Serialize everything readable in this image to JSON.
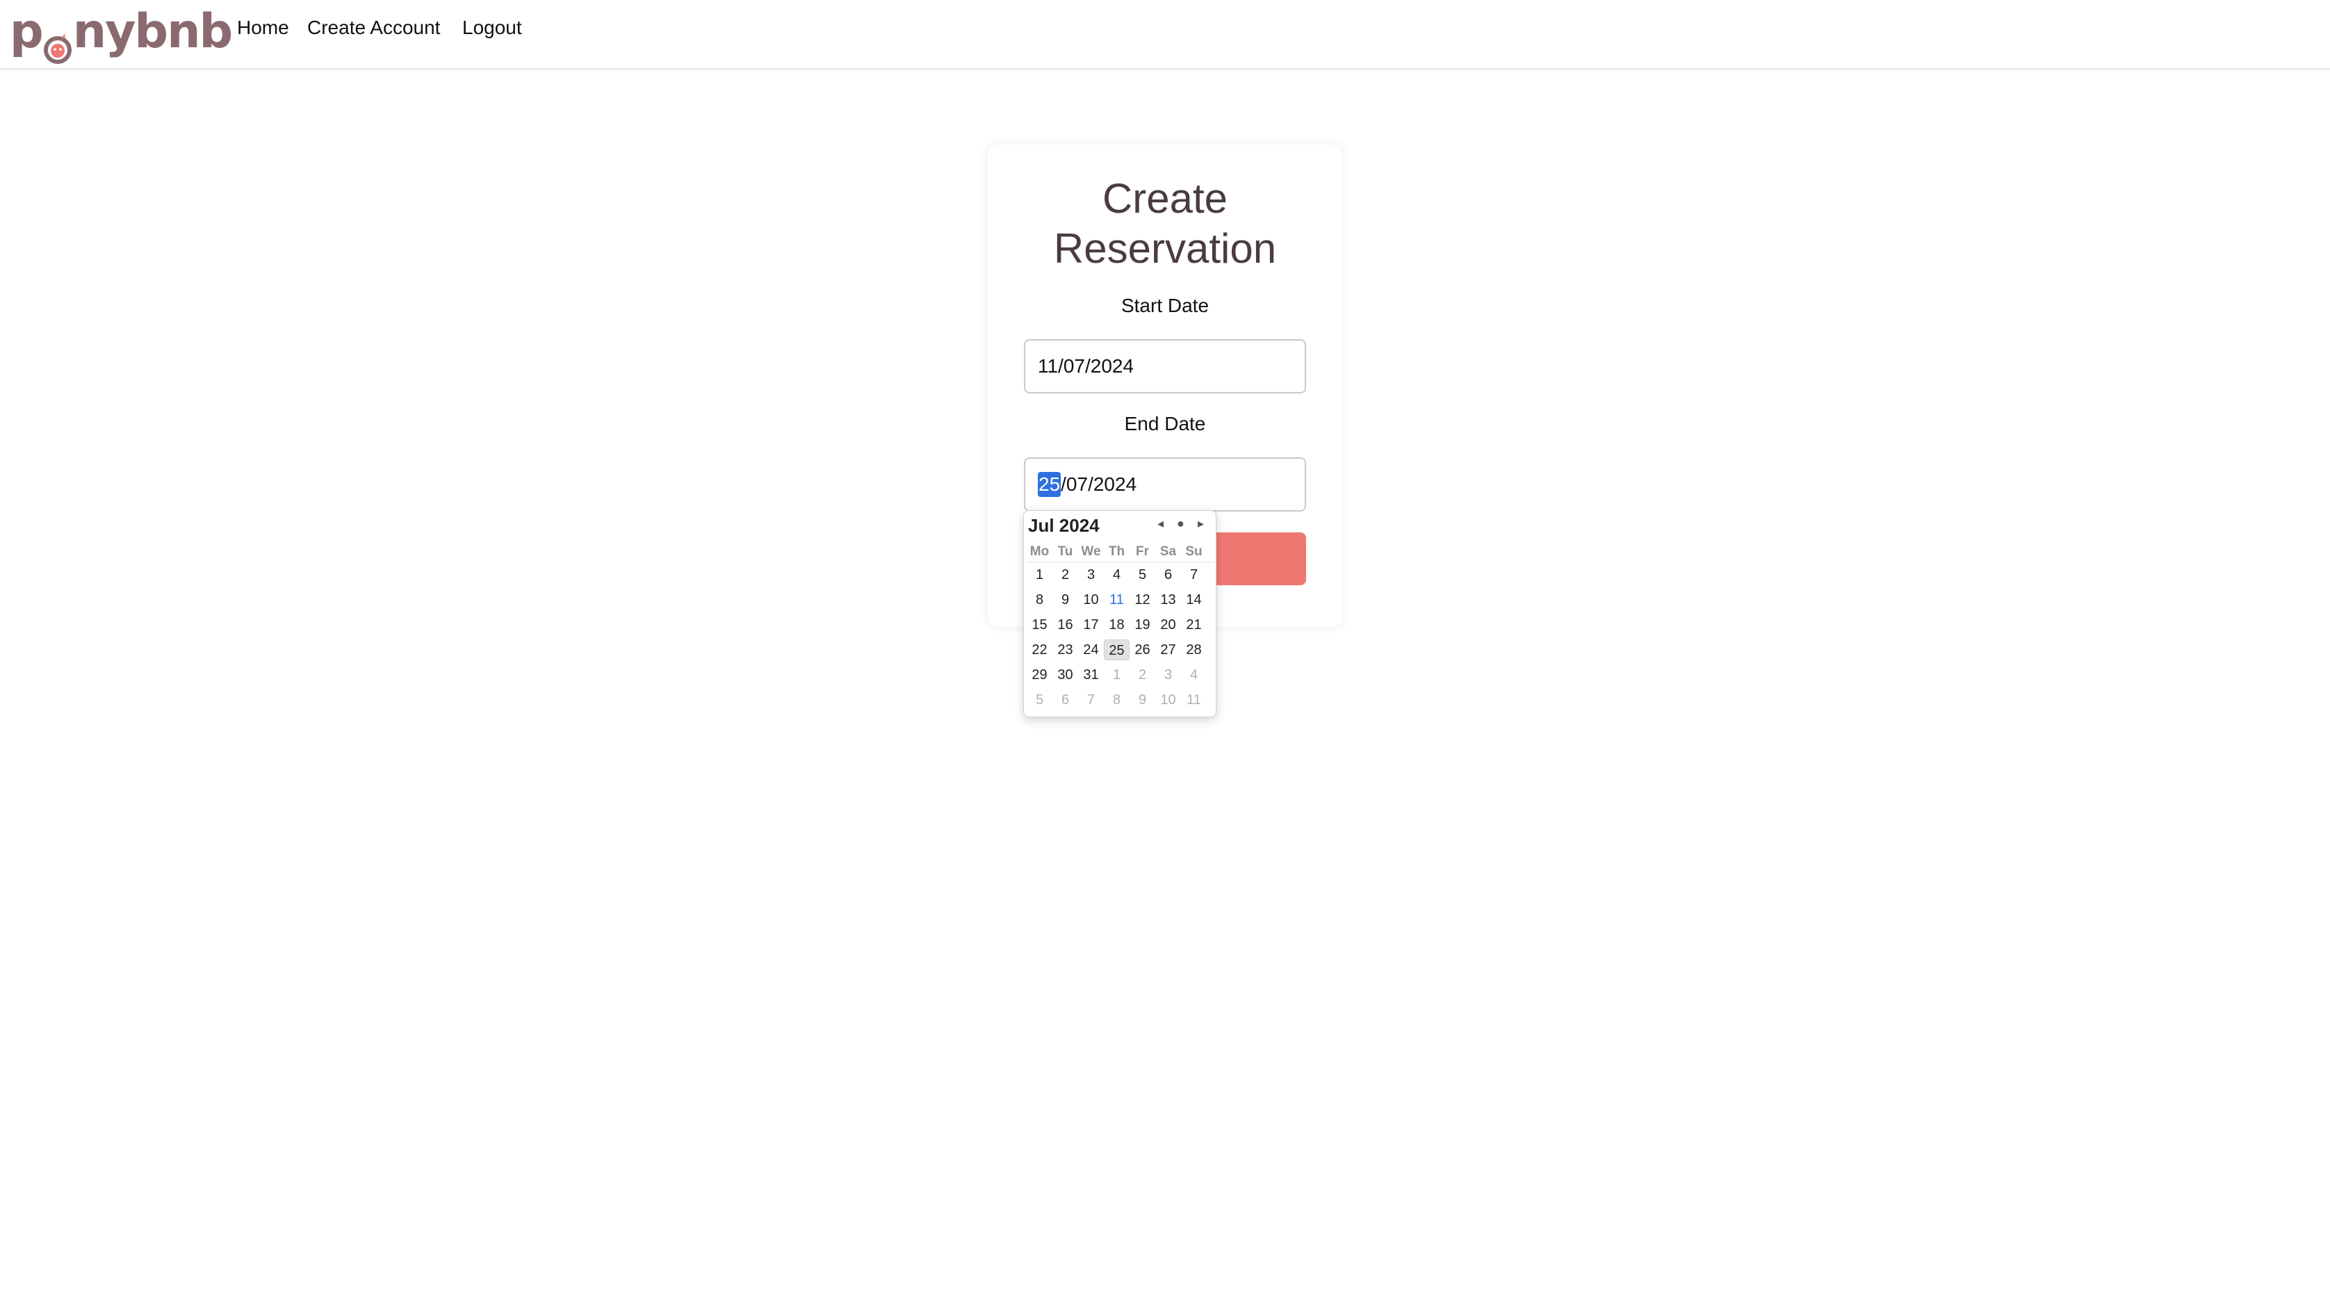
{
  "brand": {
    "logo_text_left": "p",
    "logo_text_right": "nybnb"
  },
  "nav": {
    "home": "Home",
    "create_account": "Create Account",
    "logout": "Logout"
  },
  "form": {
    "title_line1": "Create",
    "title_line2": "Reservation",
    "start_label": "Start Date",
    "start_value": "11/07/2024",
    "end_label": "End Date",
    "end_value_day": "25",
    "end_value_rest": "/07/2024"
  },
  "picker": {
    "month_label": "Jul 2024",
    "prev_icon": "◂",
    "today_icon": "●",
    "next_icon": "▸",
    "weekdays": [
      "Mo",
      "Tu",
      "We",
      "Th",
      "Fr",
      "Sa",
      "Su"
    ],
    "weeks": [
      [
        "1",
        "2",
        "3",
        "4",
        "5",
        "6",
        "7"
      ],
      [
        "8",
        "9",
        "10",
        "11",
        "12",
        "13",
        "14"
      ],
      [
        "15",
        "16",
        "17",
        "18",
        "19",
        "20",
        "21"
      ],
      [
        "22",
        "23",
        "24",
        "25",
        "26",
        "27",
        "28"
      ],
      [
        "29",
        "30",
        "31",
        "1",
        "2",
        "3",
        "4"
      ],
      [
        "5",
        "6",
        "7",
        "8",
        "9",
        "10",
        "11"
      ]
    ]
  },
  "colors": {
    "brand": "#8a6a6f",
    "accent_button": "#f07872",
    "selection": "#2f6fe0"
  }
}
